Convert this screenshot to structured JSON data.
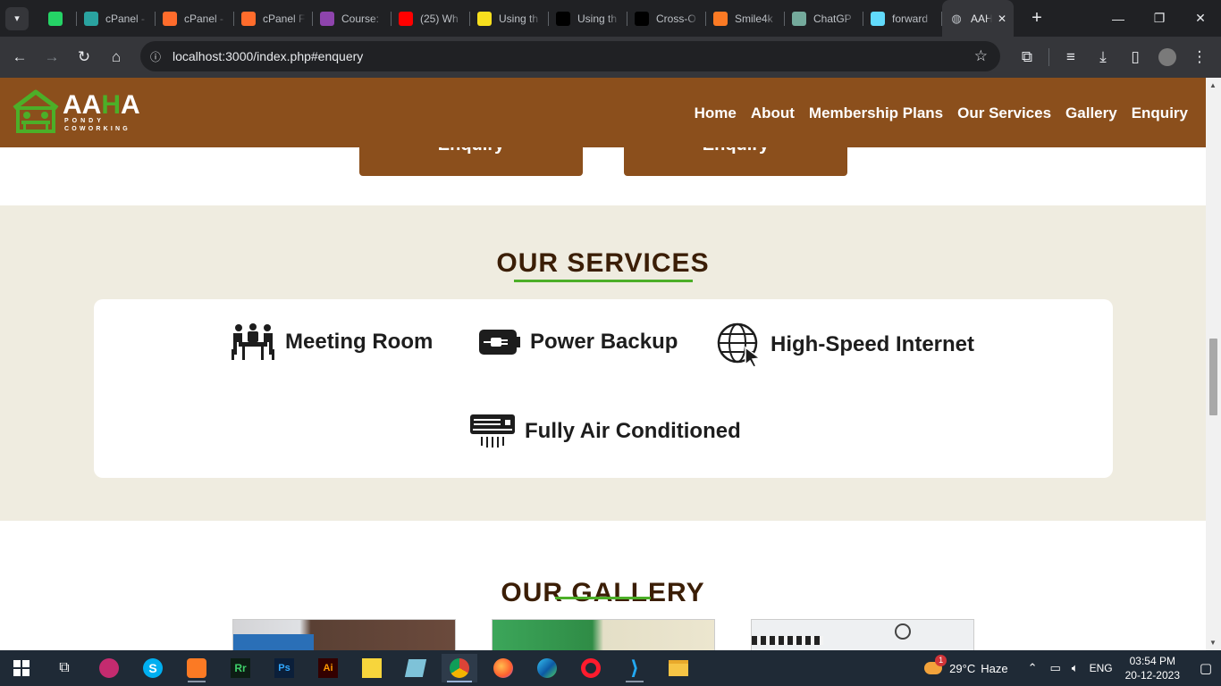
{
  "browser": {
    "tabs": [
      {
        "title": "",
        "icon": "whatsapp-icon",
        "color": "#25d366"
      },
      {
        "title": "cPanel -",
        "icon": "cpanel-icon",
        "color": "#2aa3a0"
      },
      {
        "title": "cPanel -",
        "icon": "cpanel-icon",
        "color": "#ff6c2c"
      },
      {
        "title": "cPanel F",
        "icon": "cpanel-icon",
        "color": "#ff6c2c"
      },
      {
        "title": "Course:",
        "icon": "course-icon",
        "color": "#8e44ad"
      },
      {
        "title": "(25) Wh",
        "icon": "youtube-icon",
        "color": "#ff0000"
      },
      {
        "title": "Using th",
        "icon": "js-icon",
        "color": "#f7df1e"
      },
      {
        "title": "Using th",
        "icon": "medium-icon",
        "color": "#000000"
      },
      {
        "title": "Cross-O",
        "icon": "medium-icon",
        "color": "#000000"
      },
      {
        "title": "Smile4k",
        "icon": "xampp-icon",
        "color": "#fb7a24"
      },
      {
        "title": "ChatGP",
        "icon": "chatgpt-icon",
        "color": "#74aa9c"
      },
      {
        "title": "forward",
        "icon": "react-icon",
        "color": "#61dafb"
      }
    ],
    "active_tab": {
      "title": "AAH",
      "icon": "globe-icon"
    },
    "url": "localhost:3000/index.php#enquery"
  },
  "site": {
    "logo": {
      "word_a": "AA",
      "word_h": "H",
      "word_a2": "A",
      "line1": "PONDY",
      "line2": "COWORKING"
    },
    "menu": [
      "Home",
      "About",
      "Membership Plans",
      "Our Services",
      "Gallery",
      "Enquiry"
    ],
    "prev_buttons": [
      "Enquiry",
      "Enquiry"
    ],
    "services_title": "OUR SERVICES",
    "services": [
      {
        "label": "Meeting Room",
        "icon": "meeting-room-icon"
      },
      {
        "label": "Power Backup",
        "icon": "battery-plug-icon"
      },
      {
        "label": "High-Speed Internet",
        "icon": "globe-cursor-icon"
      },
      {
        "label": "Fully Air Conditioned",
        "icon": "air-conditioner-icon"
      }
    ],
    "gallery_title": "OUR GALLERY"
  },
  "taskbar": {
    "weather": {
      "temp": "29°C",
      "cond": "Haze",
      "badge": "1"
    },
    "lang": "ENG",
    "time": "03:54 PM",
    "date": "20-12-2023"
  },
  "colors": {
    "brand_brown": "#8b4f1c",
    "brand_green": "#4caf28",
    "section_bg": "#efece0",
    "title_brown": "#3b1e06"
  }
}
